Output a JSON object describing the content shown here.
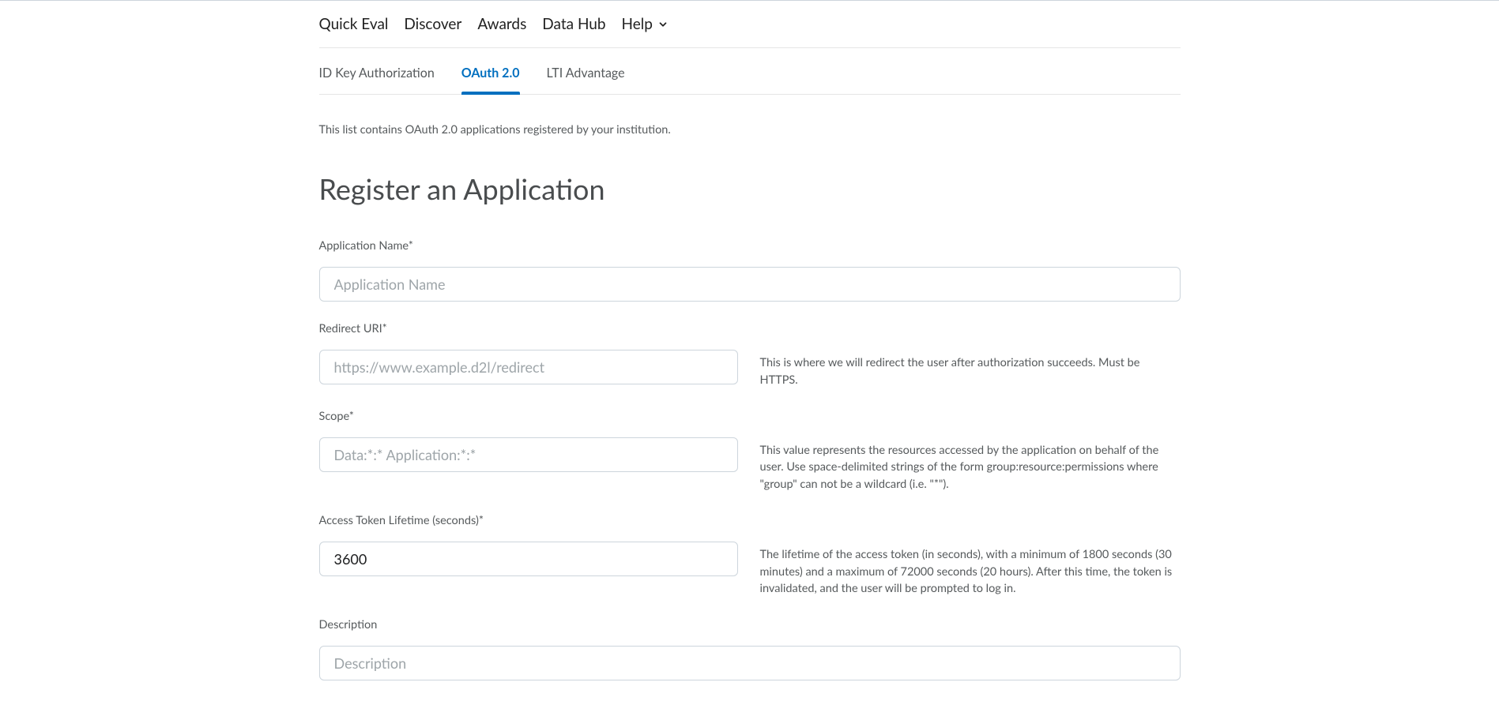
{
  "top_nav": {
    "items": [
      {
        "label": "Quick Eval"
      },
      {
        "label": "Discover"
      },
      {
        "label": "Awards"
      },
      {
        "label": "Data Hub"
      },
      {
        "label": "Help",
        "has_dropdown": true
      }
    ]
  },
  "sub_tabs": {
    "items": [
      {
        "label": "ID Key Authorization",
        "active": false
      },
      {
        "label": "OAuth 2.0",
        "active": true
      },
      {
        "label": "LTI Advantage",
        "active": false
      }
    ]
  },
  "intro": "This list contains OAuth 2.0 applications registered by your institution.",
  "page_title": "Register an Application",
  "form": {
    "app_name": {
      "label": "Application Name*",
      "placeholder": "Application Name",
      "value": ""
    },
    "redirect_uri": {
      "label": "Redirect URI*",
      "placeholder": "https://www.example.d2l/redirect",
      "value": "",
      "help": "This is where we will redirect the user after authorization succeeds. Must be HTTPS."
    },
    "scope": {
      "label": "Scope*",
      "placeholder": "Data:*:* Application:*:*",
      "value": "",
      "help": "This value represents the resources accessed by the application on behalf of the user. Use space-delimited strings of the form group:resource:permissions where \"group\" can not be a wildcard (i.e. \"*\")."
    },
    "token_lifetime": {
      "label": "Access Token Lifetime (seconds)*",
      "placeholder": "",
      "value": "3600",
      "help": "The lifetime of the access token (in seconds), with a minimum of 1800 seconds (30 minutes) and a maximum of 72000 seconds (20 hours). After this time, the token is invalidated, and the user will be prompted to log in."
    },
    "description": {
      "label": "Description",
      "placeholder": "Description",
      "value": ""
    }
  }
}
